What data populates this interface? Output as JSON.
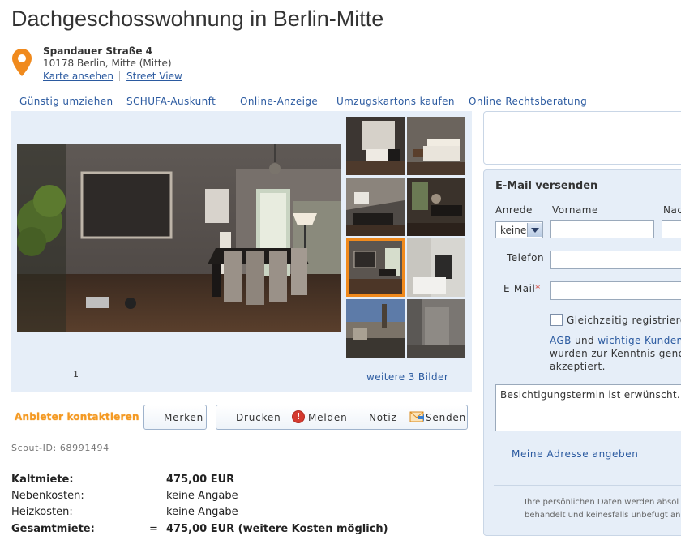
{
  "listing": {
    "title": "Dachgeschosswohnung in Berlin-Mitte",
    "street": "Spandauer Straße 4",
    "city": "10178 Berlin, Mitte (Mitte)",
    "map_link": "Karte ansehen",
    "streetview_link": "Street View"
  },
  "nav": {
    "items": [
      "Günstig umziehen",
      "SCHUFA-Auskunft",
      "Online-Anzeige",
      "Umzugskartons kaufen",
      "Online Rechtsberatung"
    ]
  },
  "gallery": {
    "page_number": "1",
    "more_link": "weitere 3 Bilder",
    "selected_thumbnail": 5
  },
  "actions": {
    "contact": "Anbieter kontaktieren",
    "merken": "Merken",
    "drucken": "Drucken",
    "melden": "Melden",
    "notiz": "Notiz",
    "senden": "Senden",
    "warn_glyph": "!"
  },
  "scout_id": "Scout-ID: 68991494",
  "costs": {
    "kalt_label": "Kaltmiete:",
    "kalt_value": "475,00 EUR",
    "neben_label": "Nebenkosten:",
    "neben_value": "keine Angabe",
    "heiz_label": "Heizkosten:",
    "heiz_value": "keine Angabe",
    "gesamt_label": "Gesamtmiete:",
    "gesamt_eq": "=",
    "gesamt_value": "475,00 EUR (weitere Kosten möglich)"
  },
  "form": {
    "heading": "E-Mail versenden",
    "anrede_label": "Anrede",
    "anrede_value": "keine",
    "vorname_label": "Vorname",
    "nachname_label": "Nac",
    "telefon_label": "Telefon",
    "email_label": "E-Mail",
    "email_required": "*",
    "register_label": "Gleichzeitig registriere",
    "agb_link": "AGB",
    "agb_and": " und ",
    "agb_kundeninfo": "wichtige Kundeni",
    "agb_line2": "wurden zur Kenntnis genor",
    "agb_line3": "akzeptiert.",
    "message": "Besichtigungstermin ist erwünscht.",
    "address_link": "Meine Adresse angeben",
    "privacy_line1": "Ihre persönlichen Daten werden absol",
    "privacy_line2": "behandelt und keinesfalls unbefugt an"
  },
  "icons": {
    "location": "map-pin-icon",
    "report": "warning-icon",
    "send": "envelope-icon"
  },
  "colors": {
    "accent_orange": "#f08a1d",
    "link_blue": "#2b5aa0",
    "panel_bg": "#e6eef8",
    "alert_red": "#d43a2f"
  }
}
